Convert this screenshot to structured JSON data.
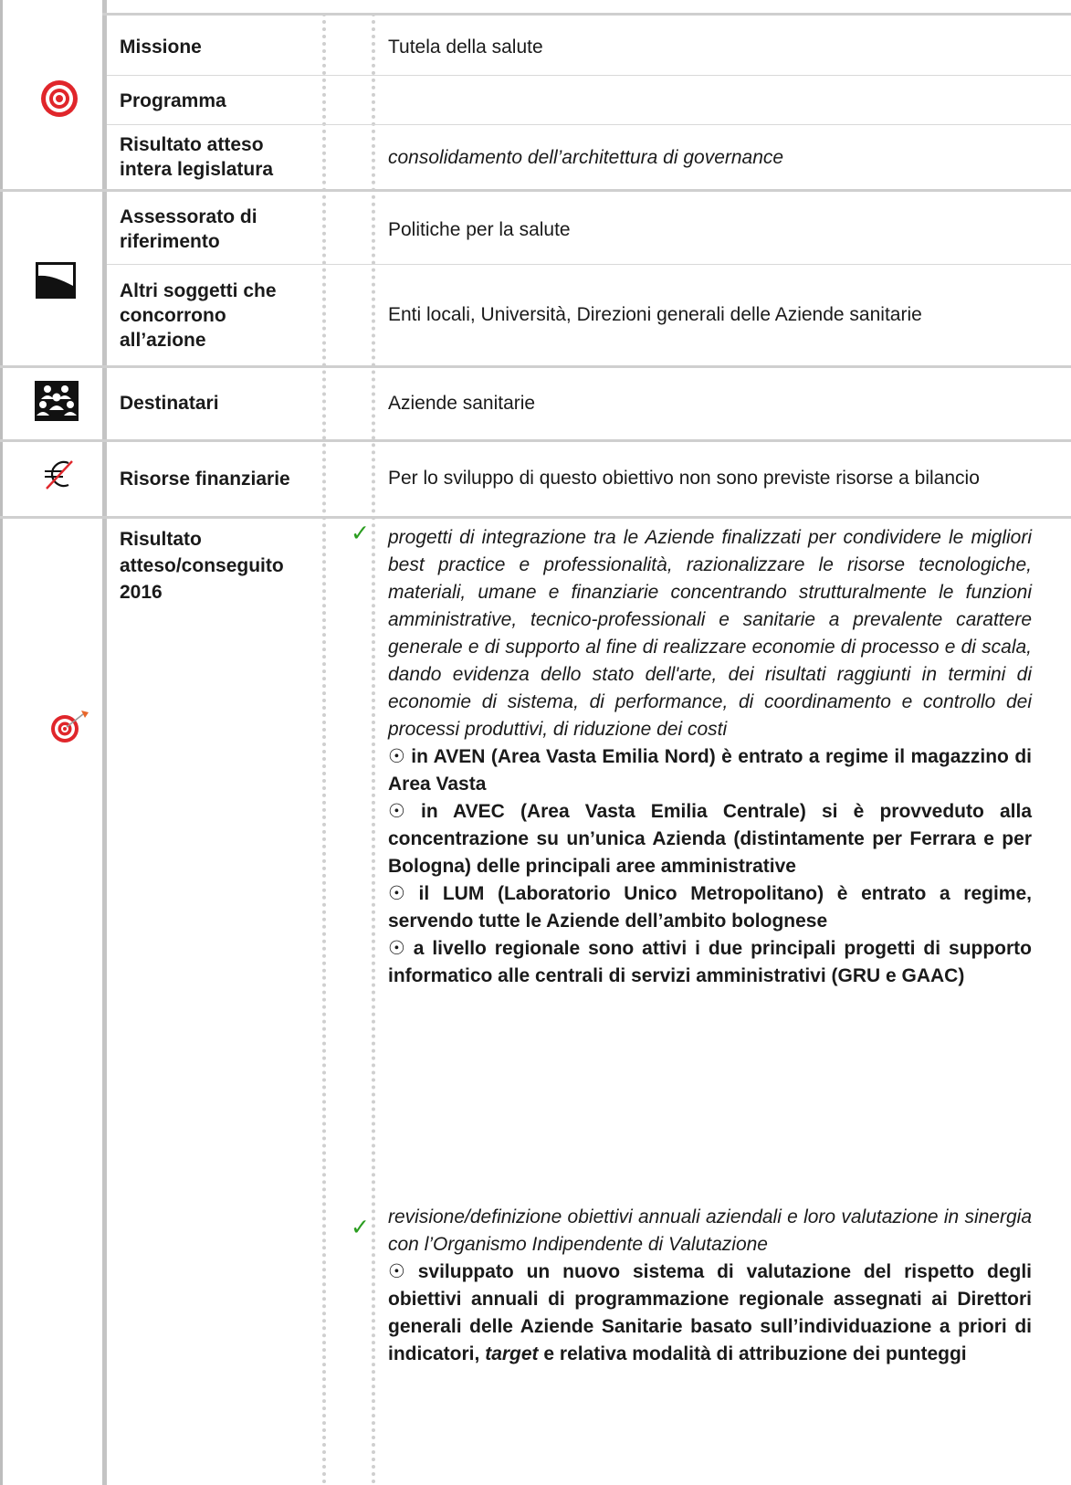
{
  "rows": {
    "missione": {
      "label": "Missione",
      "value": "Tutela della salute"
    },
    "programma": {
      "label": "Programma",
      "value": ""
    },
    "risultato_legislatura": {
      "label": "Risultato atteso intera legislatura",
      "value": "consolidamento dell’architettura di governance"
    },
    "assessorato": {
      "label": "Assessorato di riferimento",
      "value": "Politiche per la salute"
    },
    "altri_soggetti": {
      "label": "Altri soggetti che concorrono all’azione",
      "value": "Enti locali, Università, Direzioni generali delle Aziende sanitarie"
    },
    "destinatari": {
      "label": "Destinatari",
      "value": "Aziende sanitarie"
    },
    "risorse": {
      "label": "Risorse finanziarie",
      "value": "Per lo sviluppo di questo obiettivo non sono previste risorse a bilancio"
    },
    "risultato_2016": {
      "label": "Risultato atteso/conseguito 2016"
    }
  },
  "results": {
    "item1": {
      "text": "progetti di integrazione tra le Aziende finalizzati per condividere le migliori best practice e professionalità, razionalizzare le risorse tecnologiche, materiali, umane e finanziarie concentrando strutturalmente le funzioni amministrative, tecnico-professionali e sanitarie a prevalente carattere generale e di supporto al fine di realizzare economie di processo e di scala, dando evidenza dello stato dell'arte, dei risultati raggiunti in termini di economie di sistema, di performance, di coordinamento e controllo dei processi produttivi, di riduzione dei costi",
      "bullets": [
        "in AVEN (Area Vasta Emilia Nord) è entrato a regime il magazzino di Area Vasta",
        "in AVEC (Area Vasta Emilia Centrale) si è provveduto alla concentrazione su un’unica Azienda (distintamente per Ferrara e per Bologna) delle principali aree amministrative",
        "il LUM (Laboratorio Unico Metropolitano) è entrato a regime, servendo tutte le Aziende dell’ambito bolognese",
        "a livello regionale sono attivi i due principali progetti di supporto informatico alle centrali di servizi amministrativi (GRU e GAAC)"
      ]
    },
    "item2": {
      "text": "revisione/definizione obiettivi annuali aziendali e loro valutazione in sinergia con l’Organismo Indipendente di Valutazione",
      "bullet_before": "sviluppato un nuovo sistema di valutazione del rispetto degli obiettivi annuali di programmazione regionale assegnati ai Direttori generali delle Aziende Sanitarie basato sull’individuazione a priori di indicatori,",
      "bullet_emph": "target",
      "bullet_after": "e relativa modalità di attribuzione dei punteggi"
    }
  },
  "glyphs": {
    "check": "✓",
    "circle_dot": "☉"
  },
  "icons": {
    "mission": "target-icon",
    "assessorato": "region-flag-icon",
    "destinatari": "people-group-icon",
    "risorse": "crossed-euro-icon",
    "risultato": "target-dart-icon"
  },
  "colors": {
    "check": "#2a9d1f",
    "target_red": "#e0262b",
    "dart_orange": "#e8672b"
  }
}
